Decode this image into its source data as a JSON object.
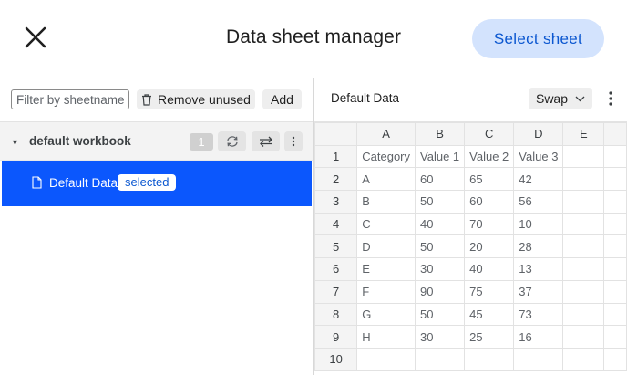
{
  "header": {
    "title": "Data sheet manager",
    "select_sheet_label": "Select sheet",
    "close_icon": "close-icon"
  },
  "left_panel": {
    "filter_placeholder": "Filter by sheetname",
    "remove_unused_label": "Remove unused",
    "add_label": "Add",
    "workbook": {
      "name": "default workbook",
      "count": "1"
    },
    "sheets": [
      {
        "name": "Default Data",
        "badge": "selected"
      }
    ]
  },
  "right_panel": {
    "sheet_title": "Default Data",
    "swap_label": "Swap",
    "columns": [
      "A",
      "B",
      "C",
      "D",
      "E"
    ],
    "rows": [
      {
        "num": "1",
        "cells": [
          "Category",
          "Value 1",
          "Value 2",
          "Value 3",
          ""
        ]
      },
      {
        "num": "2",
        "cells": [
          "A",
          "60",
          "65",
          "42",
          ""
        ]
      },
      {
        "num": "3",
        "cells": [
          "B",
          "50",
          "60",
          "56",
          ""
        ]
      },
      {
        "num": "4",
        "cells": [
          "C",
          "40",
          "70",
          "10",
          ""
        ]
      },
      {
        "num": "5",
        "cells": [
          "D",
          "50",
          "20",
          "28",
          ""
        ]
      },
      {
        "num": "6",
        "cells": [
          "E",
          "30",
          "40",
          "13",
          ""
        ]
      },
      {
        "num": "7",
        "cells": [
          "F",
          "90",
          "75",
          "37",
          ""
        ]
      },
      {
        "num": "8",
        "cells": [
          "G",
          "50",
          "45",
          "73",
          ""
        ]
      },
      {
        "num": "9",
        "cells": [
          "H",
          "30",
          "25",
          "16",
          ""
        ]
      },
      {
        "num": "10",
        "cells": [
          "",
          "",
          "",
          "",
          ""
        ]
      }
    ]
  },
  "colors": {
    "accent": "#0b57d0",
    "select_button_bg": "#d3e3fd",
    "selected_row_bg": "#0b57fd"
  }
}
